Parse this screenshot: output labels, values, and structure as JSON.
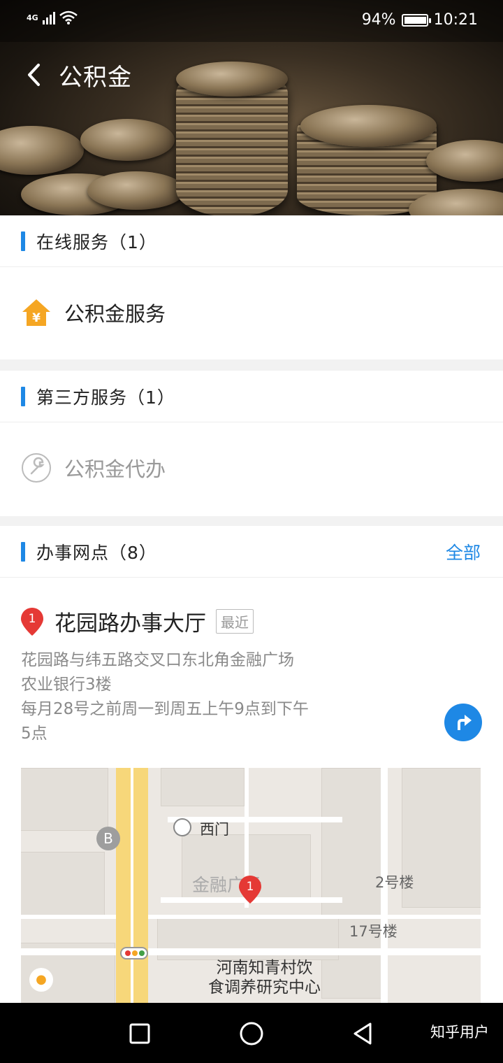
{
  "status_bar": {
    "network": "4G",
    "battery": "94%",
    "time": "10:21"
  },
  "header": {
    "title": "公积金",
    "back_icon": "chevron-left-icon"
  },
  "online_services": {
    "title": "在线服务（1）",
    "items": [
      {
        "label": "公积金服务",
        "icon": "house-yuan-icon"
      }
    ]
  },
  "third_party": {
    "title": "第三方服务（1）",
    "items": [
      {
        "label": "公积金代办",
        "icon": "wrench-icon"
      }
    ]
  },
  "branches": {
    "title": "办事网点（8）",
    "more_label": "全部",
    "items": [
      {
        "index": "1",
        "name": "花园路办事大厅",
        "badge": "最近",
        "address_line1": "花园路与纬五路交叉口东北角金融广场",
        "address_line2": "农业银行3楼",
        "hours_line1": "每月28号之前周一到周五上午9点到下午",
        "hours_line2": "5点"
      }
    ]
  },
  "map": {
    "labels": {
      "west_gate": "西门",
      "plaza": "金融广场",
      "building2": "2号楼",
      "building17": "17号楼",
      "institute_line1": "河南知青村饮",
      "institute_line2": "食调养研究中心",
      "bus": "B",
      "pin": "1"
    }
  },
  "system_nav": {
    "recent": "square-icon",
    "home": "circle-icon",
    "back": "triangle-back-icon"
  },
  "watermark": "知乎用户",
  "colors": {
    "accent": "#1e88e5",
    "pin_red": "#e53935",
    "icon_orange": "#f5a623"
  }
}
